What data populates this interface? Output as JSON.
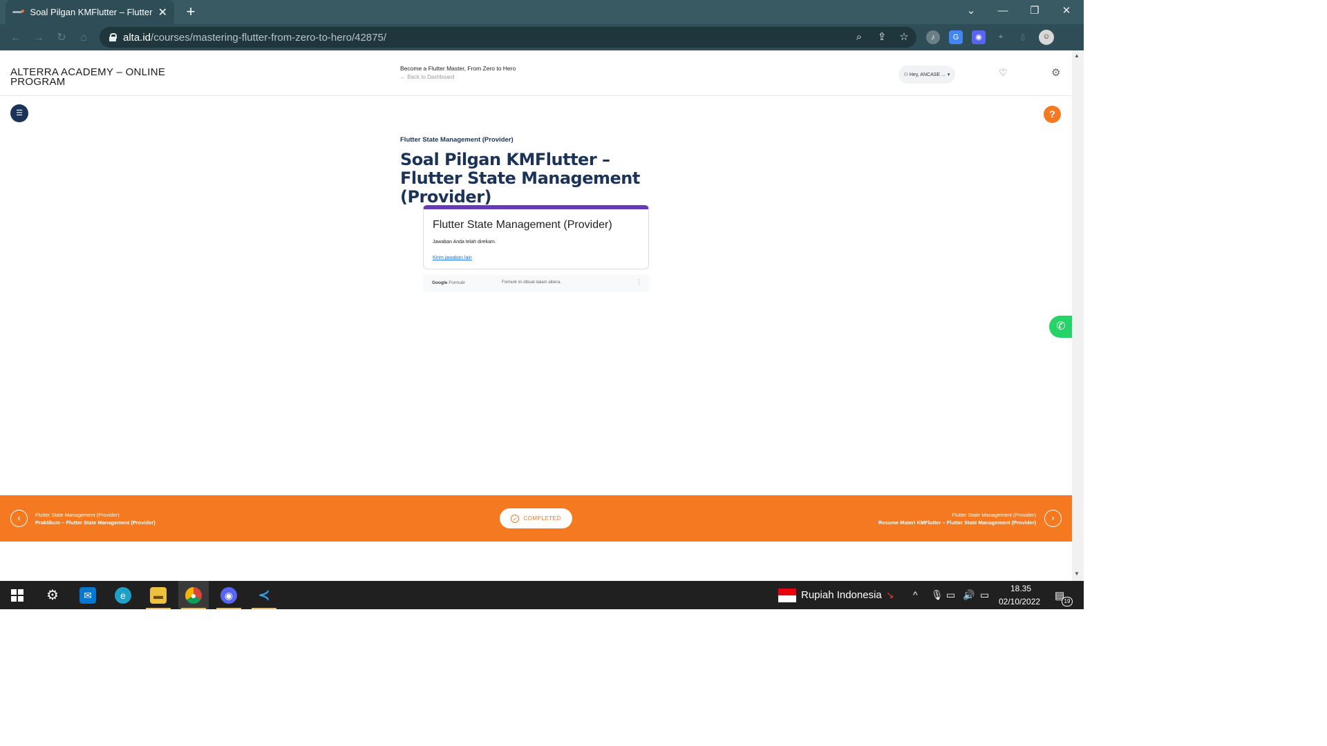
{
  "browser": {
    "tab_title": "Soal Pilgan KMFlutter – Flutter State Management (Provider)",
    "tab_close": "✕",
    "new_tab": "+",
    "url_host": "alta.id",
    "url_path": "/courses/mastering-flutter-from-zero-to-hero/42875/",
    "window_controls": [
      "⌄",
      "—",
      "❐",
      "✕"
    ]
  },
  "header": {
    "brand": "ALTERRA ACADEMY – ONLINE PROGRAM",
    "course_title": "Become a Flutter Master, From Zero to Hero",
    "back_link": "← Back to Dashboard",
    "user_greeting": "Hey, ANCASE ..."
  },
  "lesson": {
    "section": "Flutter State Management (Provider)",
    "title": "Soal Pilgan KMFlutter – Flutter State Management (Provider)"
  },
  "form": {
    "title": "Flutter State Management (Provider)",
    "message": "Jawaban Anda telah direkam.",
    "link": "Kirim jawaban lain",
    "footer_brand_bold": "Google",
    "footer_brand": " Formulir",
    "footer_note": "Formulir ini dibuat dalam alterra."
  },
  "lesson_nav": {
    "prev_section": "Flutter State Management (Provider)",
    "prev_title": "Praktikum – Flutter State Management (Provider)",
    "status": "COMPLETED",
    "next_section": "Flutter State Management (Provider)",
    "next_title": "Resume Materi KMFlutter – Flutter State Management (Provider)"
  },
  "taskbar": {
    "currency": "Rupiah Indonesia",
    "time": "18.35",
    "date": "02/10/2022",
    "notification_count": "19"
  },
  "colors": {
    "brand_orange": "#f47920",
    "brand_navy": "#1c3358",
    "forms_purple": "#673ab7",
    "chrome_teal": "#2f4d56",
    "whatsapp_green": "#25d366"
  }
}
